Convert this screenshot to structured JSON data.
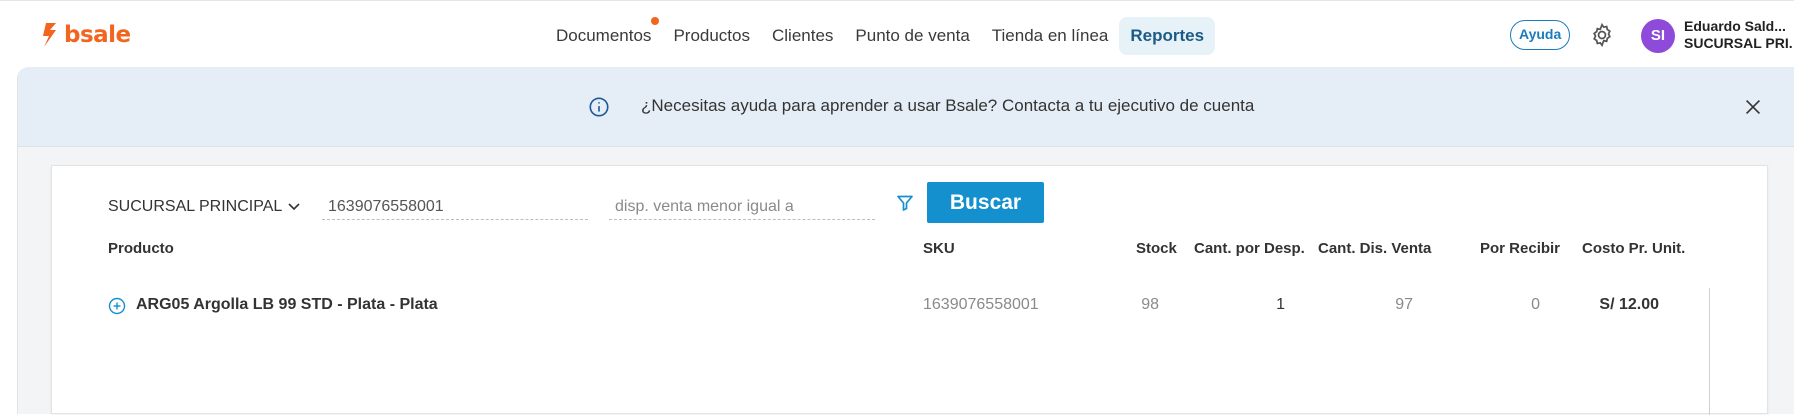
{
  "app": {
    "logo_text": "bsale",
    "brand_color": "#f3641f",
    "accent_color": "#1490cf"
  },
  "nav": {
    "items": [
      {
        "label": "Documentos",
        "notification": true
      },
      {
        "label": "Productos"
      },
      {
        "label": "Clientes"
      },
      {
        "label": "Punto de venta"
      },
      {
        "label": "Tienda en línea"
      },
      {
        "label": "Reportes",
        "active": true
      }
    ]
  },
  "header": {
    "help_label": "Ayuda",
    "settings_icon": "gear-icon",
    "avatar_initials": "SI",
    "user_name": "Eduardo Sald...",
    "user_branch": "SUCURSAL PRI..."
  },
  "banner": {
    "text": "¿Necesitas ayuda para aprender a usar Bsale? Contacta a tu ejecutivo de cuenta",
    "info_icon": "info-icon",
    "close_icon": "close-icon"
  },
  "filters": {
    "branch": "SUCURSAL PRINCIPAL",
    "sku_value": "1639076558001",
    "condition_placeholder": "disp. venta menor igual a",
    "search_label": "Buscar"
  },
  "table": {
    "columns": [
      "Producto",
      "SKU",
      "Stock",
      "Cant. por Desp.",
      "Cant. Dis. Venta",
      "Por Recibir",
      "Costo Pr. Unit."
    ],
    "rows": [
      {
        "producto": "ARG05 Argolla LB 99 STD - Plata - Plata",
        "sku": "1639076558001",
        "stock": "98",
        "por_desp": "1",
        "dis_venta": "97",
        "por_recibir": "0",
        "costo": "S/ 12.00"
      }
    ]
  }
}
